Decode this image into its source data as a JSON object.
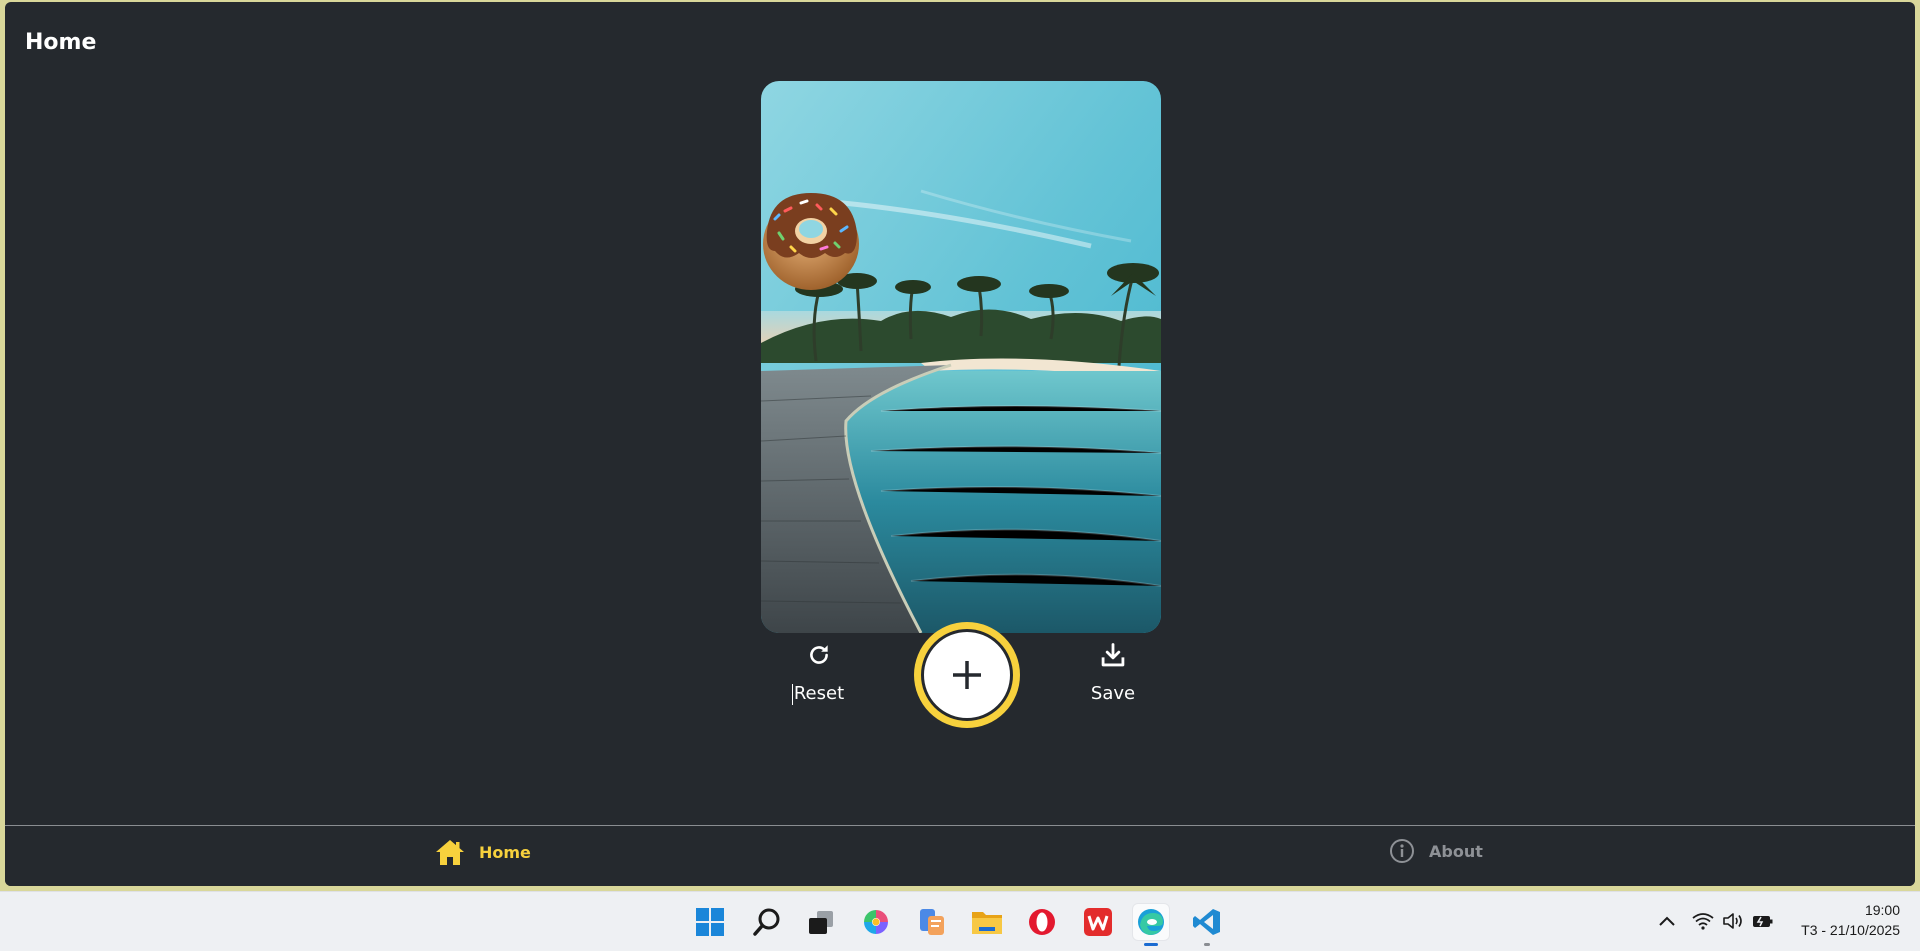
{
  "app": {
    "title": "Home",
    "actions": {
      "reset_label": "Reset",
      "save_label": "Save",
      "add_symbol": "+"
    },
    "tabs": [
      {
        "label": "Home",
        "icon": "home-icon",
        "active": true
      },
      {
        "label": "About",
        "icon": "info-icon",
        "active": false
      }
    ],
    "colors": {
      "background": "#25292e",
      "accent": "#f7d13d",
      "inactive_tab": "#8e9196",
      "text": "#ffffff"
    }
  },
  "taskbar": {
    "apps": [
      "windows-start-icon",
      "search-icon",
      "task-view-icon",
      "copilot-icon",
      "phone-link-icon",
      "file-explorer-icon",
      "opera-icon",
      "wps-office-icon",
      "edge-icon",
      "vscode-icon"
    ],
    "tray": [
      "chevron-up-icon",
      "wifi-icon",
      "volume-icon",
      "battery-icon"
    ],
    "time": "19:00",
    "date": "T3 - 21/10/2025"
  }
}
